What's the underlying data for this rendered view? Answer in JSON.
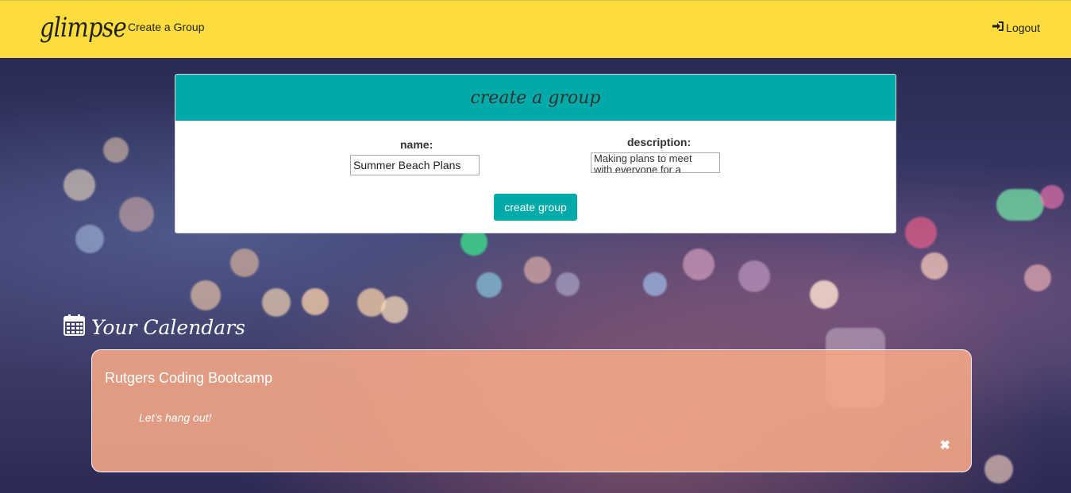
{
  "navbar": {
    "brand": "glimpse",
    "create_group_link": "Create a Group",
    "logout_label": "Logout"
  },
  "create_group_form": {
    "title": "create a group",
    "name_label": "name:",
    "name_value": "Summer Beach Plans",
    "description_label": "description:",
    "description_value": "Making plans to meet with everyone for a summer beach day!",
    "submit_label": "create group"
  },
  "calendars": {
    "heading": "Your Calendars",
    "items": [
      {
        "title": "Rutgers Coding Bootcamp",
        "description": "Let's hang out!",
        "close_glyph": "✖"
      }
    ]
  },
  "colors": {
    "navbar": "#fddd3e",
    "accent": "#00aaa8",
    "calendar_card": "#f8aa87"
  }
}
